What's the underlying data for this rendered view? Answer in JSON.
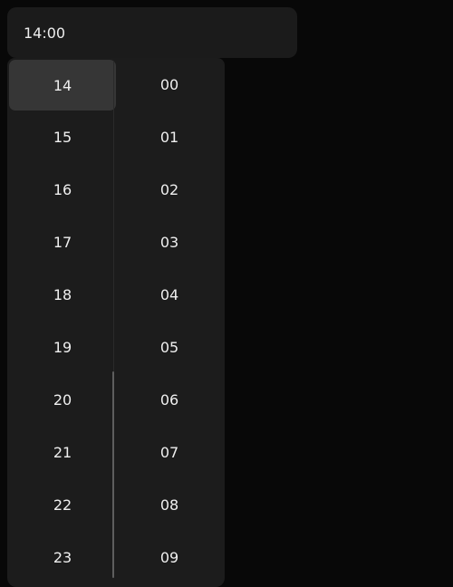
{
  "time_input": {
    "value": "14:00"
  },
  "hours": [
    "14",
    "15",
    "16",
    "17",
    "18",
    "19",
    "20",
    "21",
    "22",
    "23"
  ],
  "minutes": [
    "00",
    "01",
    "02",
    "03",
    "04",
    "05",
    "06",
    "07",
    "08",
    "09"
  ],
  "selected": {
    "hour": "14",
    "minute": "00"
  }
}
